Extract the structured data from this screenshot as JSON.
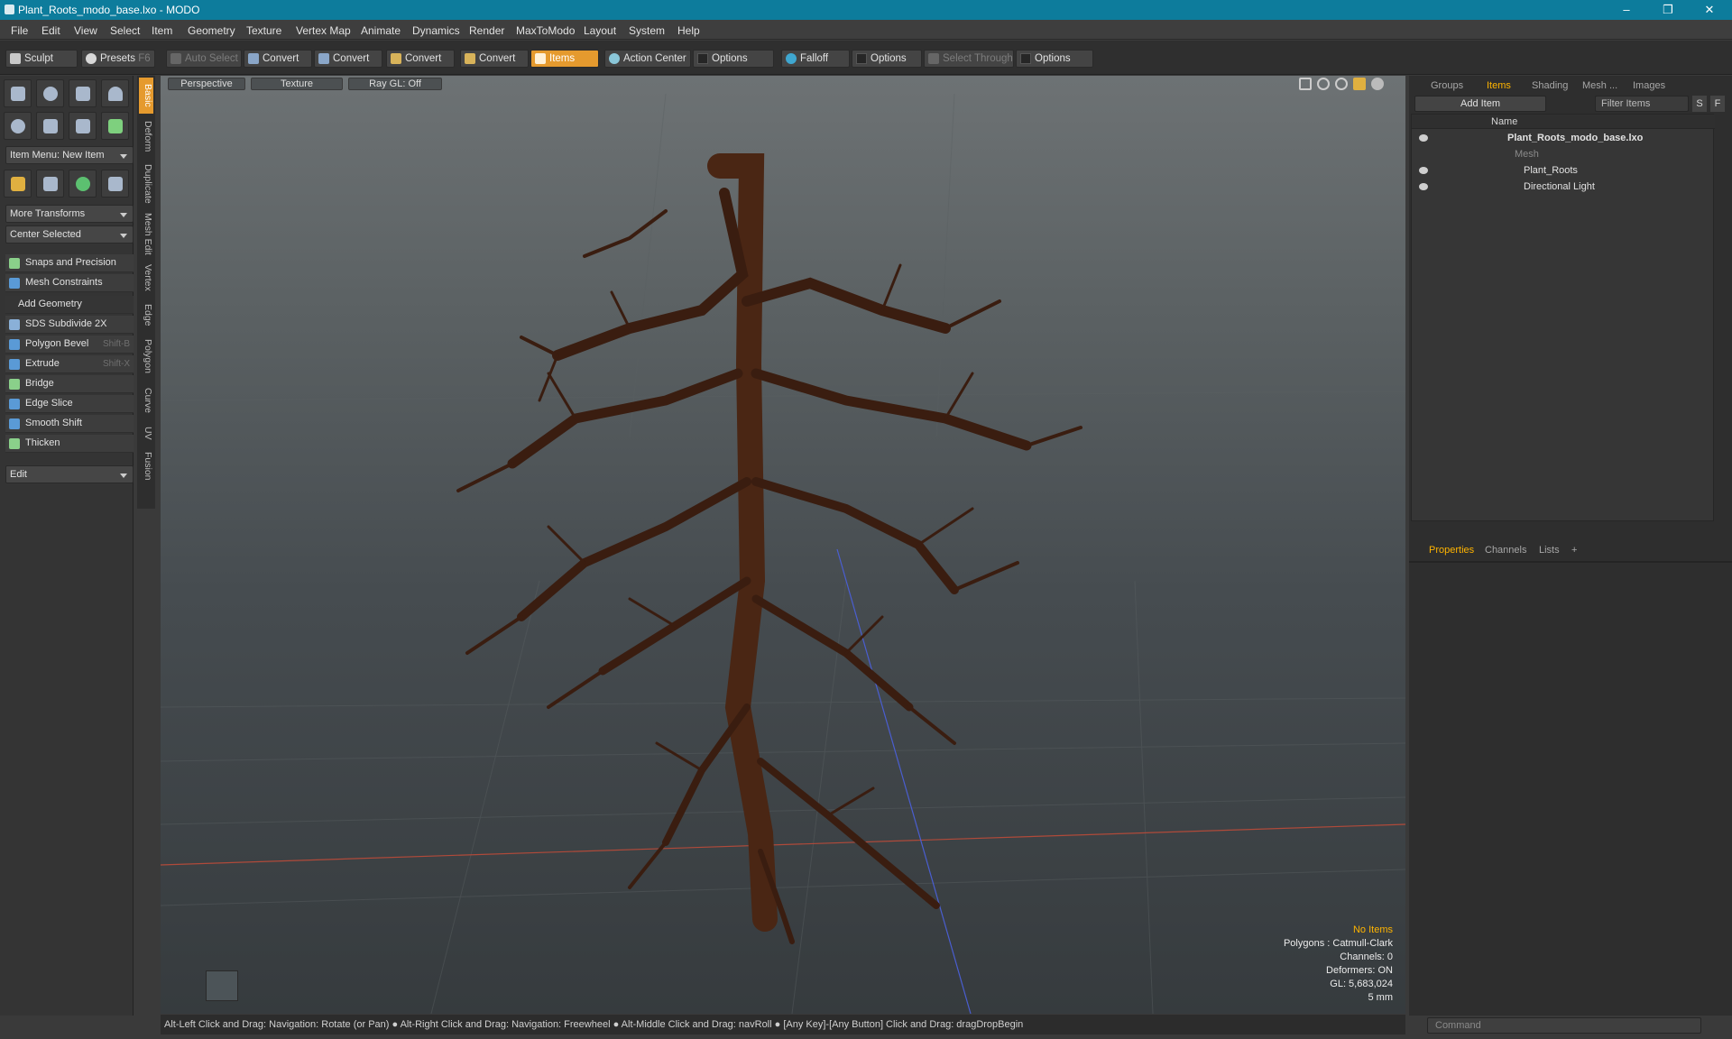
{
  "window": {
    "title": "Plant_Roots_modo_base.lxo - MODO",
    "minimize": "–",
    "maximize": "❐",
    "close": "✕"
  },
  "menu": [
    "File",
    "Edit",
    "View",
    "Select",
    "Item",
    "Geometry",
    "Texture",
    "Vertex Map",
    "Animate",
    "Dynamics",
    "Render",
    "MaxToModo",
    "Layout",
    "System",
    "Help"
  ],
  "toolbar": {
    "sculpt": "Sculpt",
    "presets": "Presets",
    "presets_key": "F6",
    "auto_select": "Auto Select",
    "convert1": "Convert",
    "convert2": "Convert",
    "convert3": "Convert",
    "convert4": "Convert",
    "items": "Items",
    "action_center": "Action Center",
    "options1": "Options",
    "falloff": "Falloff",
    "options2": "Options",
    "select_through": "Select Through",
    "options3": "Options"
  },
  "left": {
    "item_menu": "Item Menu: New Item",
    "more_transforms": "More Transforms",
    "center_selected": "Center Selected",
    "snaps": "Snaps and Precision",
    "mesh_constraints": "Mesh Constraints",
    "add_geometry": "Add Geometry",
    "tools": [
      {
        "label": "SDS Subdivide 2X",
        "shortcut": ""
      },
      {
        "label": "Polygon Bevel",
        "shortcut": "Shift-B"
      },
      {
        "label": "Extrude",
        "shortcut": "Shift-X"
      },
      {
        "label": "Bridge",
        "shortcut": ""
      },
      {
        "label": "Edge Slice",
        "shortcut": ""
      },
      {
        "label": "Smooth Shift",
        "shortcut": ""
      },
      {
        "label": "Thicken",
        "shortcut": ""
      }
    ],
    "edit": "Edit"
  },
  "vtabs": [
    "Basic",
    "Deform",
    "Duplicate",
    "Mesh Edit",
    "Vertex",
    "Edge",
    "Polygon",
    "Curve",
    "UV",
    "Fusion"
  ],
  "viewport": {
    "view": "Perspective",
    "shading": "Texture",
    "raygl": "Ray GL: Off",
    "hud": {
      "selection": "No Items",
      "polygons": "Polygons : Catmull-Clark",
      "channels": "Channels: 0",
      "deformers": "Deformers: ON",
      "gl": "GL: 5,683,024",
      "scale": "5 mm"
    }
  },
  "right": {
    "tabs": [
      "Groups",
      "Items",
      "Shading",
      "Mesh ...",
      "Images"
    ],
    "add_item": "Add Item",
    "filter": "Filter Items",
    "filter_s": "S",
    "filter_f": "F",
    "col_name": "Name",
    "tree": [
      {
        "label": "Plant_Roots_modo_base.lxo"
      },
      {
        "label": "Mesh"
      },
      {
        "label": "Plant_Roots"
      },
      {
        "label": "Directional Light"
      }
    ],
    "prop_tabs": [
      "Properties",
      "Channels",
      "Lists"
    ],
    "plus": "+"
  },
  "status": "Alt-Left Click and Drag: Navigation: Rotate (or Pan) ● Alt-Right Click and Drag: Navigation: Freewheel ● Alt-Middle Click and Drag: navRoll ● [Any Key]-[Any Button] Click and Drag: dragDropBegin",
  "command": "Command",
  "colors": {
    "accent": "#e59a2e",
    "titlebar": "#0d7c9c",
    "hud_highlight": "#ffb400",
    "root": "#3a1d10"
  }
}
